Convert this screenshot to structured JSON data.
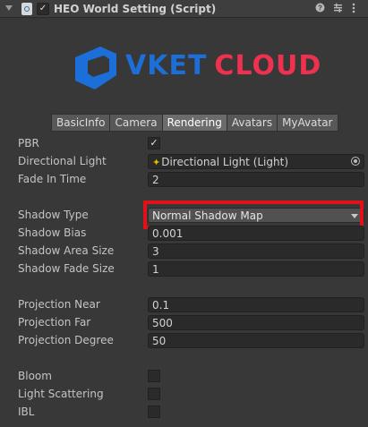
{
  "header": {
    "title": "HEO World Setting (Script)",
    "enabled": "✓",
    "icons": [
      "help-icon",
      "preset-icon",
      "menu-icon"
    ]
  },
  "logo": {
    "text_vket": "VKET",
    "text_cloud": "CLOUD",
    "colors": {
      "vket": "#1c6fd9",
      "cloud": "#f0304f",
      "mark": "#1c6fd9"
    }
  },
  "tabs": [
    "BasicInfo",
    "Camera",
    "Rendering",
    "Avatars",
    "MyAvatar"
  ],
  "active_tab": "Rendering",
  "fields": {
    "pbr": {
      "label": "PBR",
      "checked": "✓"
    },
    "directional_light": {
      "label": "Directional Light",
      "value": "Directional Light (Light)"
    },
    "fade_in_time": {
      "label": "Fade In Time",
      "value": "2"
    },
    "shadow_type": {
      "label": "Shadow Type",
      "value": "Normal Shadow Map"
    },
    "shadow_bias": {
      "label": "Shadow Bias",
      "value": "0.001"
    },
    "shadow_area_size": {
      "label": "Shadow Area Size",
      "value": "3"
    },
    "shadow_fade_size": {
      "label": "Shadow Fade Size",
      "value": "1"
    },
    "projection_near": {
      "label": "Projection Near",
      "value": "0.1"
    },
    "projection_far": {
      "label": "Projection Far",
      "value": "500"
    },
    "projection_degree": {
      "label": "Projection Degree",
      "value": "50"
    },
    "bloom": {
      "label": "Bloom",
      "checked": ""
    },
    "light_scattering": {
      "label": "Light Scattering",
      "checked": ""
    },
    "ibl": {
      "label": "IBL",
      "checked": ""
    }
  },
  "highlight_color": "#e01219"
}
